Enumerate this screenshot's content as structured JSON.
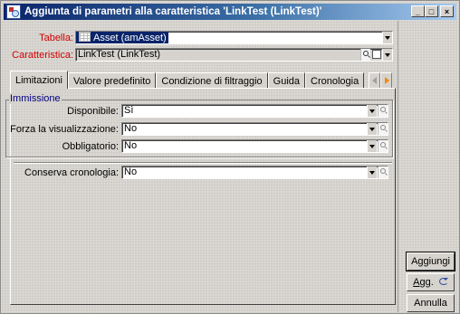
{
  "window": {
    "title": "Aggiunta di parametri alla caratteristica 'LinkTest (LinkTest)'",
    "controls": [
      "_",
      "□",
      "×"
    ]
  },
  "header": {
    "table_label": "Tabella:",
    "table_value": "Asset (amAsset)",
    "feature_label": "Caratteristica:",
    "feature_value": "LinkTest (LinkTest)"
  },
  "tabs": [
    {
      "label": "Limitazioni",
      "active": true
    },
    {
      "label": "Valore predefinito",
      "active": false
    },
    {
      "label": "Condizione di filtraggio",
      "active": false
    },
    {
      "label": "Guida",
      "active": false
    },
    {
      "label": "Cronologia",
      "active": false
    }
  ],
  "immissione": {
    "group_title": "Immissione",
    "disponibile_label": "Disponibile:",
    "disponibile_value": "Sì",
    "forza_label": "Forza la visualizzazione:",
    "forza_value": "No",
    "obbligatorio_label": "Obbligatorio:",
    "obbligatorio_value": "No"
  },
  "cronologia": {
    "label": "Conserva cronologia:",
    "value": "No"
  },
  "buttons": {
    "add": "Aggiungi",
    "add_refresh_prefix": "A",
    "add_refresh_rest": "gg.",
    "cancel": "Annulla"
  },
  "colors": {
    "title_start": "#0a246a",
    "title_end": "#a6caf0",
    "required_label": "#d40000",
    "group_title": "#000080",
    "window_bg": "#d6d3ce"
  },
  "icons": [
    "app-icon",
    "table-icon",
    "magnifier-icon",
    "grid-icon",
    "dropdown-arrow-icon",
    "tab-scroll-left-icon",
    "tab-scroll-right-icon",
    "refresh-icon"
  ]
}
